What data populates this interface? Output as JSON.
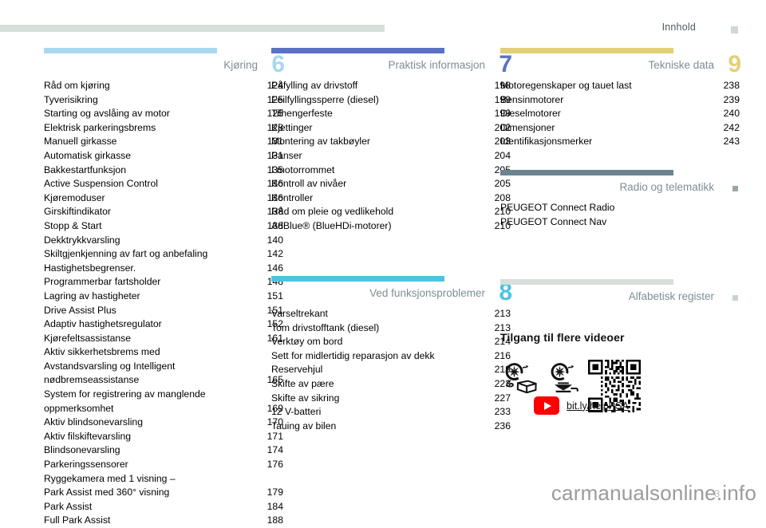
{
  "header": {
    "title": "Innhold",
    "rule_color": "#d6dfd9",
    "marker_color": "#ced9d2"
  },
  "footer": {
    "watermark": "carmanualsonline.info",
    "folio": "3"
  },
  "colors": {
    "light_blue": "#a7d8ef",
    "periwinkle": "#5b72c4",
    "cyan": "#4ec3e0",
    "sand": "#e3cf78",
    "slate": "#6b8391",
    "pale_green": "#d6dfd9",
    "title_gray": "#7d8e95",
    "youtube_red": "#ff0000"
  },
  "sections": [
    {
      "id": "kjoring",
      "title": "Kjøring",
      "number": "6",
      "bar_color": "#a7d8ef",
      "number_color": "#a7d8ef",
      "marker": false,
      "entries": [
        {
          "label": "Råd om kjøring",
          "page": "124"
        },
        {
          "label": "Tyverisikring",
          "page": "125"
        },
        {
          "label": "Starting og avslåing av motor",
          "page": "125"
        },
        {
          "label": "Elektrisk parkeringsbrems",
          "page": "128"
        },
        {
          "label": "Manuell girkasse",
          "page": "131"
        },
        {
          "label": "Automatisk girkasse",
          "page": "131"
        },
        {
          "label": "Bakkestartfunksjon",
          "page": "135"
        },
        {
          "label": "Active Suspension Control",
          "page": "136"
        },
        {
          "label": "Kjøremoduser",
          "page": "136"
        },
        {
          "label": "Girskiftindikator",
          "page": "138"
        },
        {
          "label": "Stopp & Start",
          "page": "138"
        },
        {
          "label": "Dekktrykkvarsling",
          "page": "140"
        },
        {
          "label": "Skiltgjenkjenning av fart og anbefaling",
          "page": "142"
        },
        {
          "label": "Hastighetsbegrenser.",
          "page": "146"
        },
        {
          "label": "Programmerbar fartsholder",
          "page": "148"
        },
        {
          "label": "Lagring av hastigheter",
          "page": "151"
        },
        {
          "label": "Drive Assist Plus",
          "page": "151"
        },
        {
          "label": "Adaptiv hastighetsregulator",
          "page": "152"
        },
        {
          "label": "Kjørefeltsassistanse",
          "page": "161"
        },
        {
          "label": "Aktiv sikkerhetsbrems med\nAvstandsvarsling og Intelligent\nnødbremseassistanse",
          "page": "165"
        },
        {
          "label": "System for registrering av manglende\noppmerksomhet",
          "page": "169"
        },
        {
          "label": "Aktiv blindsonevarsling",
          "page": "170"
        },
        {
          "label": "Aktiv filskiftevarsling",
          "page": "171"
        },
        {
          "label": "Blindsonevarsling",
          "page": "174"
        },
        {
          "label": "Parkeringssensorer",
          "page": "176"
        },
        {
          "label": "Ryggekamera med 1 visning –\nPark Assist med 360° visning",
          "page": "179"
        },
        {
          "label": "Park Assist",
          "page": "184"
        },
        {
          "label": "Full Park Assist",
          "page": "188"
        }
      ]
    },
    {
      "id": "praktisk-informasjon",
      "title": "Praktisk informasjon",
      "number": "7",
      "bar_color": "#5b72c4",
      "number_color": "#5b72c4",
      "marker": false,
      "entries": [
        {
          "label": "Påfylling av drivstoff",
          "page": "198"
        },
        {
          "label": "Feilfyllingssperre (diesel)",
          "page": "199"
        },
        {
          "label": "Tilhengerfeste",
          "page": "199"
        },
        {
          "label": "Kjettinger",
          "page": "202"
        },
        {
          "label": "Montering av takbøyler",
          "page": "203"
        },
        {
          "label": "Panser",
          "page": "204"
        },
        {
          "label": "I motorrommet",
          "page": "205"
        },
        {
          "label": "Kontroll av nivåer",
          "page": "205"
        },
        {
          "label": "Kontroller",
          "page": "208"
        },
        {
          "label": "Råd om pleie og vedlikehold",
          "page": "210"
        },
        {
          "label": "AdBlue® (BlueHDi-motorer)",
          "page": "210"
        }
      ]
    },
    {
      "id": "ved-funksjonsproblemer",
      "title": "Ved funksjonsproblemer",
      "number": "8",
      "bar_color": "#4ec3e0",
      "number_color": "#4ec3e0",
      "marker": false,
      "entries": [
        {
          "label": "Varseltrekant",
          "page": "213"
        },
        {
          "label": "Tom drivstofftank (diesel)",
          "page": "213"
        },
        {
          "label": "Verktøy om bord",
          "page": "214"
        },
        {
          "label": "Sett for midlertidig reparasjon av dekk",
          "page": "216"
        },
        {
          "label": "Reservehjul",
          "page": "219"
        },
        {
          "label": "Skifte av pære",
          "page": "223"
        },
        {
          "label": "Skifte av sikring",
          "page": "227"
        },
        {
          "label": "12 V-batteri",
          "page": "233"
        },
        {
          "label": "Tauing av bilen",
          "page": "236"
        }
      ]
    },
    {
      "id": "tekniske-data",
      "title": "Tekniske data",
      "number": "9",
      "bar_color": "#e3cf78",
      "number_color": "#e3cf78",
      "marker": false,
      "entries": [
        {
          "label": "Motoregenskaper og tauet last",
          "page": "238"
        },
        {
          "label": "Bensinmotorer",
          "page": "239"
        },
        {
          "label": "Dieselmotorer",
          "page": "240"
        },
        {
          "label": "Dimensjoner",
          "page": "242"
        },
        {
          "label": "Identifikasjonsmerker",
          "page": "243"
        }
      ]
    },
    {
      "id": "radio-og-telematikk",
      "title": "Radio og telematikk",
      "number": "",
      "bar_color": "#6b8391",
      "number_color": "#6b8391",
      "marker": true,
      "marker_color": "#9aa8a5",
      "entries": [
        {
          "label": "PEUGEOT Connect Radio",
          "page": ""
        },
        {
          "label": "PEUGEOT Connect Nav",
          "page": ""
        }
      ]
    },
    {
      "id": "alfabetisk-register",
      "title": "Alfabetisk register",
      "number": "",
      "bar_color": "#d6dfd9",
      "number_color": "#d6dfd9",
      "marker": true,
      "marker_color": "#c8d4cf",
      "entries": []
    }
  ],
  "video": {
    "title": "Tilgang til flere videoer",
    "link_label": "bit.ly/helpPSA",
    "pictograms": [
      "tire-repair-kit-icon",
      "tire-jack-icon"
    ],
    "qr_label": "qr-code-icon",
    "play_label": "youtube-play-icon"
  }
}
